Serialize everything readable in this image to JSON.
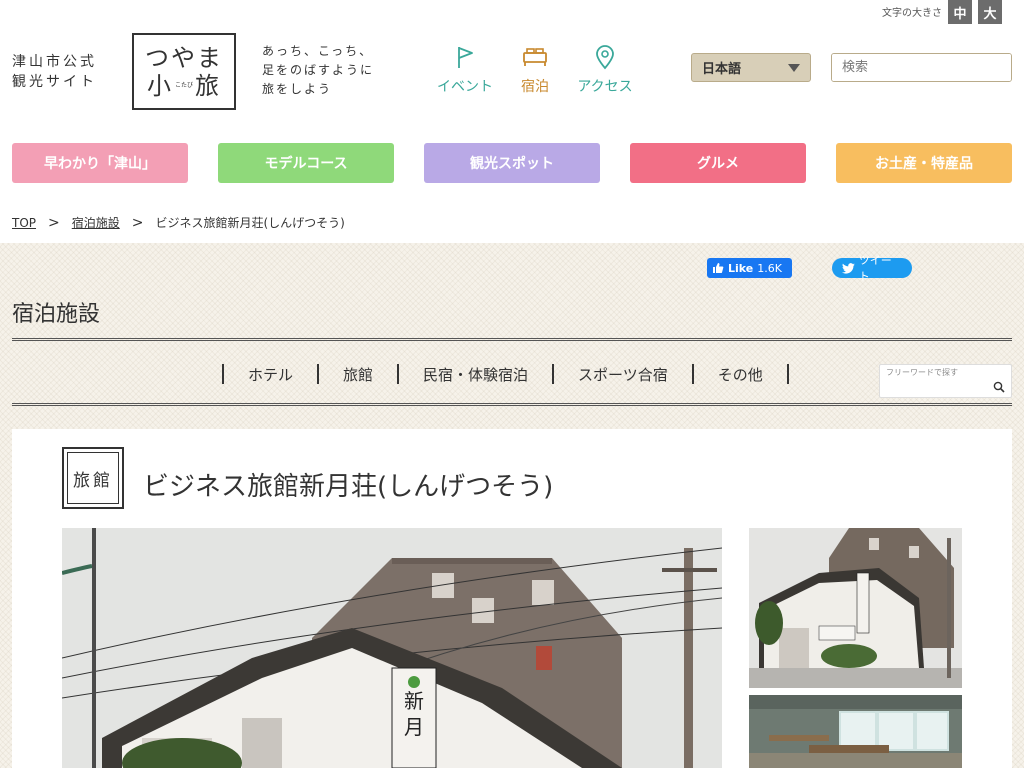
{
  "header": {
    "site_label_line1": "津山市公式",
    "site_label_line2": "観光サイト",
    "logo_top": "つやま",
    "logo_left": "小",
    "logo_ruby": "こたび",
    "logo_right": "旅",
    "tagline_line1": "あっち、こっち、",
    "tagline_line2": "足をのばすように",
    "tagline_line3": "旅をしよう",
    "nav": [
      {
        "label": "イベント",
        "icon": "flag-icon",
        "color": "#3aa89a"
      },
      {
        "label": "宿泊",
        "icon": "bed-icon",
        "color": "#c8892e"
      },
      {
        "label": "アクセス",
        "icon": "map-pin-icon",
        "color": "#3aa89a"
      }
    ],
    "font_size_label": "文字の大きさ",
    "font_size_mid": "中",
    "font_size_large": "大",
    "language": "日本語",
    "search_placeholder": "検索"
  },
  "categories": [
    {
      "label": "早わかり「津山」",
      "color": "#f39fb5"
    },
    {
      "label": "モデルコース",
      "color": "#8fd97a"
    },
    {
      "label": "観光スポット",
      "color": "#b9a9e6"
    },
    {
      "label": "グルメ",
      "color": "#f26f86"
    },
    {
      "label": "お土産・特産品",
      "color": "#f8be5f"
    }
  ],
  "breadcrumb": {
    "top": "TOP",
    "sep": ">",
    "parent": "宿泊施設",
    "current": "ビジネス旅館新月荘(しんげつそう)"
  },
  "social": {
    "fb_label": "Like",
    "fb_count": "1.6K",
    "tw_label": "ツイート"
  },
  "section": {
    "title": "宿泊施設",
    "subnav": [
      "ホテル",
      "旅館",
      "民宿・体験宿泊",
      "スポーツ合宿",
      "その他"
    ],
    "free_search_placeholder": "フリーワードで探す"
  },
  "detail": {
    "badge": "旅館",
    "title": "ビジネス旅館新月荘(しんげつそう)",
    "sign_text": "新月"
  },
  "colors": {
    "accent_gold": "#b9a56e",
    "select_bg": "#d8cfb8"
  }
}
